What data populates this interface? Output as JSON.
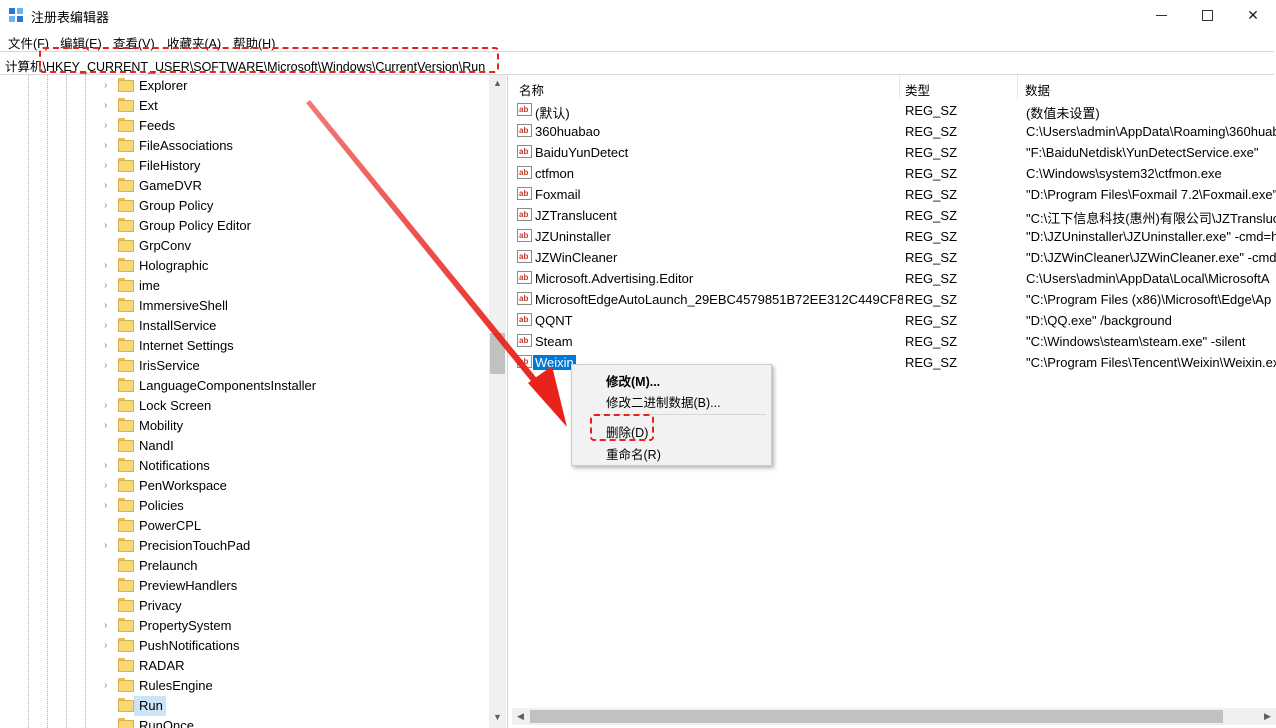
{
  "window": {
    "title": "注册表编辑器",
    "icon": "regedit-icon",
    "minimize_icon": "minimize-icon",
    "maximize_icon": "maximize-icon",
    "close_icon": "close-icon",
    "close_glyph": "✕"
  },
  "menu": [
    "文件(F)",
    "编辑(E)",
    "查看(V)",
    "收藏夹(A)",
    "帮助(H)"
  ],
  "address": {
    "value": "计算机\\HKEY_CURRENT_USER\\SOFTWARE\\Microsoft\\Windows\\CurrentVersion\\Run"
  },
  "tree": {
    "items": [
      {
        "label": "Explorer",
        "expandable": true
      },
      {
        "label": "Ext",
        "expandable": true
      },
      {
        "label": "Feeds",
        "expandable": true
      },
      {
        "label": "FileAssociations",
        "expandable": true
      },
      {
        "label": "FileHistory",
        "expandable": true
      },
      {
        "label": "GameDVR",
        "expandable": true
      },
      {
        "label": "Group Policy",
        "expandable": true
      },
      {
        "label": "Group Policy Editor",
        "expandable": true
      },
      {
        "label": "GrpConv",
        "expandable": false
      },
      {
        "label": "Holographic",
        "expandable": true
      },
      {
        "label": "ime",
        "expandable": true
      },
      {
        "label": "ImmersiveShell",
        "expandable": true
      },
      {
        "label": "InstallService",
        "expandable": true
      },
      {
        "label": "Internet Settings",
        "expandable": true
      },
      {
        "label": "IrisService",
        "expandable": true
      },
      {
        "label": "LanguageComponentsInstaller",
        "expandable": false
      },
      {
        "label": "Lock Screen",
        "expandable": true
      },
      {
        "label": "Mobility",
        "expandable": true
      },
      {
        "label": "NandI",
        "expandable": false
      },
      {
        "label": "Notifications",
        "expandable": true
      },
      {
        "label": "PenWorkspace",
        "expandable": true
      },
      {
        "label": "Policies",
        "expandable": true
      },
      {
        "label": "PowerCPL",
        "expandable": false
      },
      {
        "label": "PrecisionTouchPad",
        "expandable": true
      },
      {
        "label": "Prelaunch",
        "expandable": false
      },
      {
        "label": "PreviewHandlers",
        "expandable": false
      },
      {
        "label": "Privacy",
        "expandable": false
      },
      {
        "label": "PropertySystem",
        "expandable": true
      },
      {
        "label": "PushNotifications",
        "expandable": true
      },
      {
        "label": "RADAR",
        "expandable": false
      },
      {
        "label": "RulesEngine",
        "expandable": true
      },
      {
        "label": "Run",
        "expandable": false,
        "selected": true
      },
      {
        "label": "RunOnce",
        "expandable": false
      }
    ]
  },
  "list": {
    "columns": [
      "名称",
      "类型",
      "数据"
    ],
    "rows": [
      {
        "name": "(默认)",
        "type": "REG_SZ",
        "data": "(数值未设置)"
      },
      {
        "name": "360huabao",
        "type": "REG_SZ",
        "data": "C:\\Users\\admin\\AppData\\Roaming\\360huab"
      },
      {
        "name": "BaiduYunDetect",
        "type": "REG_SZ",
        "data": "\"F:\\BaiduNetdisk\\YunDetectService.exe\""
      },
      {
        "name": "ctfmon",
        "type": "REG_SZ",
        "data": "C:\\Windows\\system32\\ctfmon.exe"
      },
      {
        "name": "Foxmail",
        "type": "REG_SZ",
        "data": "\"D:\\Program Files\\Foxmail 7.2\\Foxmail.exe\""
      },
      {
        "name": "JZTranslucent",
        "type": "REG_SZ",
        "data": "\"C:\\江下信息科技(惠州)有限公司\\JZTransluce"
      },
      {
        "name": "JZUninstaller",
        "type": "REG_SZ",
        "data": "\"D:\\JZUninstaller\\JZUninstaller.exe\" -cmd=h"
      },
      {
        "name": "JZWinCleaner",
        "type": "REG_SZ",
        "data": "\"D:\\JZWinCleaner\\JZWinCleaner.exe\" -cmd="
      },
      {
        "name": "Microsoft.Advertising.Editor",
        "type": "REG_SZ",
        "data": "C:\\Users\\admin\\AppData\\Local\\MicrosoftA"
      },
      {
        "name": "MicrosoftEdgeAutoLaunch_29EBC4579851B72EE312C449CF8...",
        "type": "REG_SZ",
        "data": "\"C:\\Program Files (x86)\\Microsoft\\Edge\\Ap"
      },
      {
        "name": "QQNT",
        "type": "REG_SZ",
        "data": "\"D:\\QQ.exe\" /background"
      },
      {
        "name": "Steam",
        "type": "REG_SZ",
        "data": "\"C:\\Windows\\steam\\steam.exe\" -silent"
      },
      {
        "name": "Weixin",
        "type": "REG_SZ",
        "data": "\"C:\\Program Files\\Tencent\\Weixin\\Weixin.ex",
        "selected": true
      }
    ],
    "value_icon_text": "ab"
  },
  "context_menu": {
    "items": [
      {
        "label": "修改(M)...",
        "bold": true
      },
      {
        "label": "修改二进制数据(B)..."
      },
      {
        "label": "删除(D)"
      },
      {
        "label": "重命名(R)"
      }
    ]
  },
  "colors": {
    "annotation": "#e8231b",
    "selection": "#0078d7"
  }
}
